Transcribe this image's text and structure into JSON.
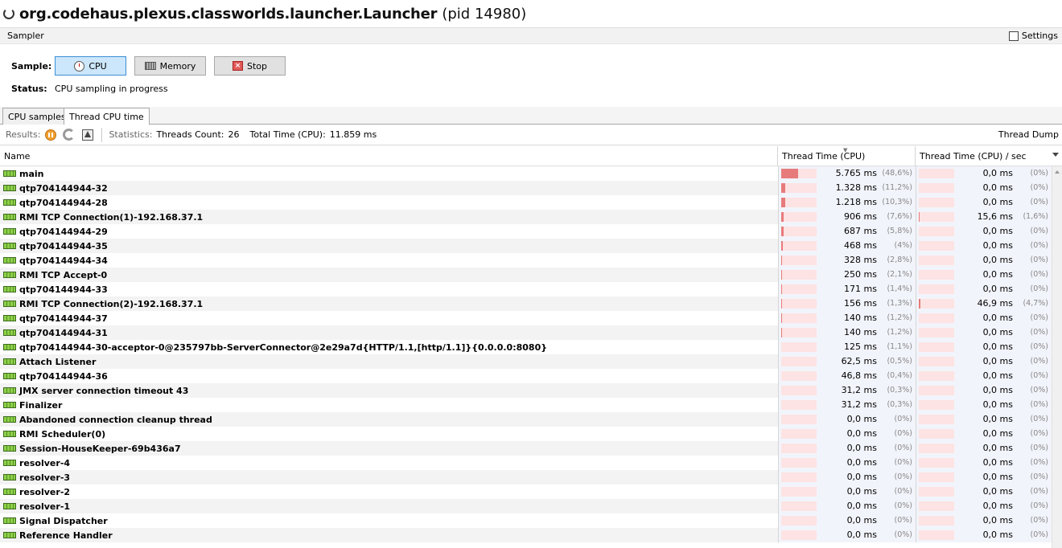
{
  "title": {
    "app": "org.codehaus.plexus.classworlds.launcher.Launcher",
    "pid": "(pid 14980)"
  },
  "sampler": {
    "label": "Sampler",
    "settings_label": "Settings"
  },
  "sample": {
    "label": "Sample:",
    "cpu_label": "CPU",
    "memory_label": "Memory",
    "stop_label": "Stop",
    "status_label": "Status:",
    "status_text": "CPU sampling in progress"
  },
  "tabs": [
    {
      "label": "CPU samples"
    },
    {
      "label": "Thread CPU time"
    }
  ],
  "results": {
    "label": "Results:",
    "stats_label": "Statistics:",
    "threads_count_label": "Threads Count:",
    "threads_count": "26",
    "total_time_label": "Total Time (CPU):",
    "total_time": "11.859 ms",
    "thread_dump_label": "Thread Dump"
  },
  "columns": {
    "name": "Name",
    "thread_time": "Thread Time (CPU)",
    "thread_time_sec": "Thread Time (CPU) / sec"
  },
  "colors": {
    "bar_fill": "#e77b7b",
    "bar_bg": "#fde3e3",
    "active_button": "#cce6fb"
  },
  "threads": [
    {
      "name": "main",
      "time": "5.765 ms",
      "pct": "(48,6%)",
      "frac": 0.486,
      "sec": "0,0 ms",
      "sec_pct": "(0%)",
      "sec_frac": 0
    },
    {
      "name": "qtp704144944-32",
      "time": "1.328 ms",
      "pct": "(11,2%)",
      "frac": 0.112,
      "sec": "0,0 ms",
      "sec_pct": "(0%)",
      "sec_frac": 0
    },
    {
      "name": "qtp704144944-28",
      "time": "1.218 ms",
      "pct": "(10,3%)",
      "frac": 0.103,
      "sec": "0,0 ms",
      "sec_pct": "(0%)",
      "sec_frac": 0
    },
    {
      "name": "RMI TCP Connection(1)-192.168.37.1",
      "time": "906 ms",
      "pct": "(7,6%)",
      "frac": 0.076,
      "sec": "15,6 ms",
      "sec_pct": "(1,6%)",
      "sec_frac": 0.016
    },
    {
      "name": "qtp704144944-29",
      "time": "687 ms",
      "pct": "(5,8%)",
      "frac": 0.058,
      "sec": "0,0 ms",
      "sec_pct": "(0%)",
      "sec_frac": 0
    },
    {
      "name": "qtp704144944-35",
      "time": "468 ms",
      "pct": "(4%)",
      "frac": 0.04,
      "sec": "0,0 ms",
      "sec_pct": "(0%)",
      "sec_frac": 0
    },
    {
      "name": "qtp704144944-34",
      "time": "328 ms",
      "pct": "(2,8%)",
      "frac": 0.028,
      "sec": "0,0 ms",
      "sec_pct": "(0%)",
      "sec_frac": 0
    },
    {
      "name": "RMI TCP Accept-0",
      "time": "250 ms",
      "pct": "(2,1%)",
      "frac": 0.021,
      "sec": "0,0 ms",
      "sec_pct": "(0%)",
      "sec_frac": 0
    },
    {
      "name": "qtp704144944-33",
      "time": "171 ms",
      "pct": "(1,4%)",
      "frac": 0.014,
      "sec": "0,0 ms",
      "sec_pct": "(0%)",
      "sec_frac": 0
    },
    {
      "name": "RMI TCP Connection(2)-192.168.37.1",
      "time": "156 ms",
      "pct": "(1,3%)",
      "frac": 0.013,
      "sec": "46,9 ms",
      "sec_pct": "(4,7%)",
      "sec_frac": 0.047
    },
    {
      "name": "qtp704144944-37",
      "time": "140 ms",
      "pct": "(1,2%)",
      "frac": 0.012,
      "sec": "0,0 ms",
      "sec_pct": "(0%)",
      "sec_frac": 0
    },
    {
      "name": "qtp704144944-31",
      "time": "140 ms",
      "pct": "(1,2%)",
      "frac": 0.012,
      "sec": "0,0 ms",
      "sec_pct": "(0%)",
      "sec_frac": 0
    },
    {
      "name": "qtp704144944-30-acceptor-0@235797bb-ServerConnector@2e29a7d{HTTP/1.1,[http/1.1]}{0.0.0.0:8080}",
      "time": "125 ms",
      "pct": "(1,1%)",
      "frac": 0.011,
      "sec": "0,0 ms",
      "sec_pct": "(0%)",
      "sec_frac": 0
    },
    {
      "name": "Attach Listener",
      "time": "62,5 ms",
      "pct": "(0,5%)",
      "frac": 0.005,
      "sec": "0,0 ms",
      "sec_pct": "(0%)",
      "sec_frac": 0
    },
    {
      "name": "qtp704144944-36",
      "time": "46,8 ms",
      "pct": "(0,4%)",
      "frac": 0.004,
      "sec": "0,0 ms",
      "sec_pct": "(0%)",
      "sec_frac": 0
    },
    {
      "name": "JMX server connection timeout 43",
      "time": "31,2 ms",
      "pct": "(0,3%)",
      "frac": 0.003,
      "sec": "0,0 ms",
      "sec_pct": "(0%)",
      "sec_frac": 0
    },
    {
      "name": "Finalizer",
      "time": "31,2 ms",
      "pct": "(0,3%)",
      "frac": 0.003,
      "sec": "0,0 ms",
      "sec_pct": "(0%)",
      "sec_frac": 0
    },
    {
      "name": "Abandoned connection cleanup thread",
      "time": "0,0 ms",
      "pct": "(0%)",
      "frac": 0,
      "sec": "0,0 ms",
      "sec_pct": "(0%)",
      "sec_frac": 0
    },
    {
      "name": "RMI Scheduler(0)",
      "time": "0,0 ms",
      "pct": "(0%)",
      "frac": 0,
      "sec": "0,0 ms",
      "sec_pct": "(0%)",
      "sec_frac": 0
    },
    {
      "name": "Session-HouseKeeper-69b436a7",
      "time": "0,0 ms",
      "pct": "(0%)",
      "frac": 0,
      "sec": "0,0 ms",
      "sec_pct": "(0%)",
      "sec_frac": 0
    },
    {
      "name": "resolver-4",
      "time": "0,0 ms",
      "pct": "(0%)",
      "frac": 0,
      "sec": "0,0 ms",
      "sec_pct": "(0%)",
      "sec_frac": 0
    },
    {
      "name": "resolver-3",
      "time": "0,0 ms",
      "pct": "(0%)",
      "frac": 0,
      "sec": "0,0 ms",
      "sec_pct": "(0%)",
      "sec_frac": 0
    },
    {
      "name": "resolver-2",
      "time": "0,0 ms",
      "pct": "(0%)",
      "frac": 0,
      "sec": "0,0 ms",
      "sec_pct": "(0%)",
      "sec_frac": 0
    },
    {
      "name": "resolver-1",
      "time": "0,0 ms",
      "pct": "(0%)",
      "frac": 0,
      "sec": "0,0 ms",
      "sec_pct": "(0%)",
      "sec_frac": 0
    },
    {
      "name": "Signal Dispatcher",
      "time": "0,0 ms",
      "pct": "(0%)",
      "frac": 0,
      "sec": "0,0 ms",
      "sec_pct": "(0%)",
      "sec_frac": 0
    },
    {
      "name": "Reference Handler",
      "time": "0,0 ms",
      "pct": "(0%)",
      "frac": 0,
      "sec": "0,0 ms",
      "sec_pct": "(0%)",
      "sec_frac": 0
    }
  ]
}
